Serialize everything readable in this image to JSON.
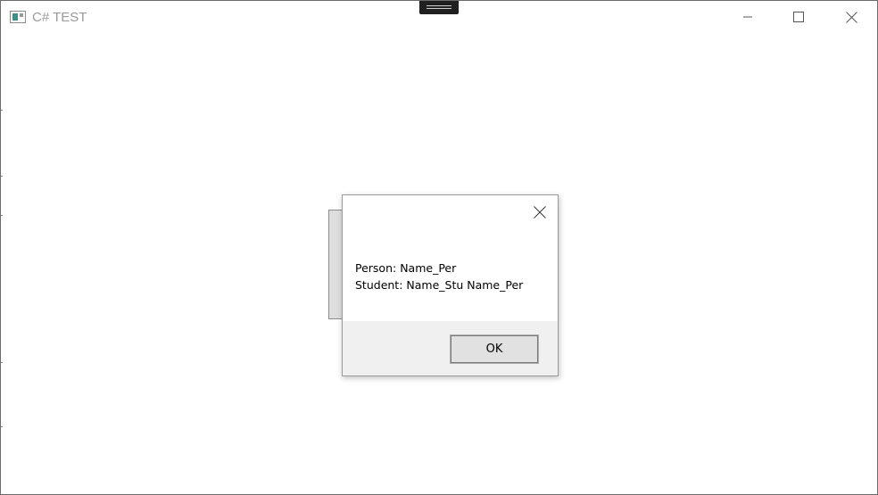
{
  "window": {
    "title": "C# TEST",
    "icons": {
      "app": "app-window-icon",
      "minimize": "minimize-icon",
      "maximize": "maximize-icon",
      "close": "close-icon"
    }
  },
  "dialog": {
    "lines": [
      "Person: Name_Per",
      "Student: Name_Stu Name_Per"
    ],
    "ok_label": "OK",
    "close_icon": "close-icon"
  },
  "colors": {
    "title_text": "#9a9a9a",
    "dialog_footer": "#f0f0f0",
    "button_face": "#e1e1e1"
  }
}
